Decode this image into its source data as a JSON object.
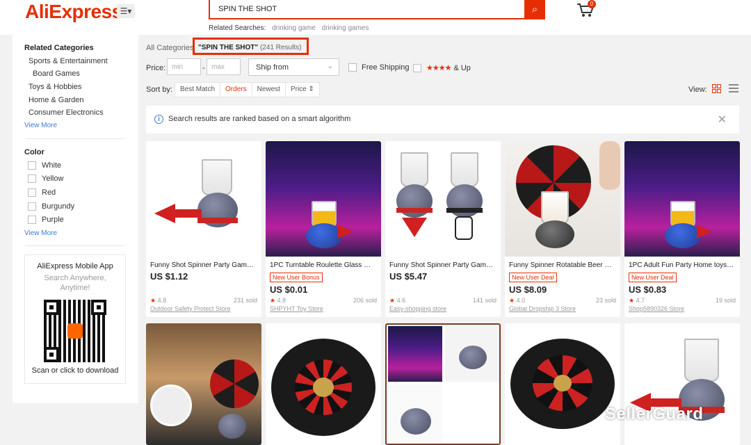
{
  "header": {
    "logo": "AliExpress",
    "search_value": "SPIN THE SHOT",
    "related_label": "Related Searches:",
    "related": [
      "drinking game",
      "drinking games"
    ],
    "cart_count": "0"
  },
  "sidebar": {
    "related_title": "Related Categories",
    "categories": [
      "Sports & Entertainment",
      "Board Games",
      "Toys & Hobbies",
      "Home & Garden",
      "Consumer Electronics"
    ],
    "view_more_1": "View More",
    "color_title": "Color",
    "colors": [
      "White",
      "Yellow",
      "Red",
      "Burgundy",
      "Purple"
    ],
    "view_more_2": "View More",
    "app": {
      "title": "AliExpress Mobile App",
      "sub1": "Search Anywhere,",
      "sub2": "Anytime!",
      "scan": "Scan or click to download"
    }
  },
  "filters": {
    "all_categories": "All Categories",
    "query_label": "\"SPIN THE SHOT\"",
    "results": "(241 Results)",
    "price_label": "Price:",
    "min_placeholder": "min",
    "max_placeholder": "max",
    "dash": "-",
    "ship_from": "Ship from",
    "free_shipping": "Free Shipping",
    "stars": "★★★★",
    "and_up": "& Up",
    "sort_label": "Sort by:",
    "sort_options": [
      "Best Match",
      "Orders",
      "Newest",
      "Price ⇕"
    ],
    "view_label": "View:"
  },
  "notice": {
    "text": "Search results are ranked based on a smart algorithm",
    "icon": "info-icon",
    "close": "✕"
  },
  "products": [
    {
      "title": "Funny Shot Spinner Party Game R...",
      "badge": "",
      "price": "US $1.12",
      "rating": "4.8",
      "sold": "231 sold",
      "store": "Outdoor Safety Protect Store"
    },
    {
      "title": "1PC Turntable Roulette Glass Nove...",
      "badge": "New User Bonus",
      "price": "US $0.01",
      "rating": "4.8",
      "sold": "206 sold",
      "store": "SHPYHT Toy Store"
    },
    {
      "title": "Funny Shot Spinner Party Game R...",
      "badge": "",
      "price": "US $5.47",
      "rating": "4.6",
      "sold": "141 sold",
      "store": "Easy-shopping store"
    },
    {
      "title": "Funny Spinner Rotatable Beer Win...",
      "badge": "New User Deal",
      "price": "US $8.09",
      "rating": "4.0",
      "sold": "23 sold",
      "store": "Global Dropship 3 Store"
    },
    {
      "title": "1PC Adult Fun Party Home toys Tu...",
      "badge": "New User Deal",
      "price": "US $0.83",
      "rating": "4.7",
      "sold": "19 sold",
      "store": "Shop5890326 Store"
    }
  ],
  "watermark": "SellerGuard",
  "colors": {
    "accent": "#e62e04",
    "link": "#3a7bd5"
  }
}
